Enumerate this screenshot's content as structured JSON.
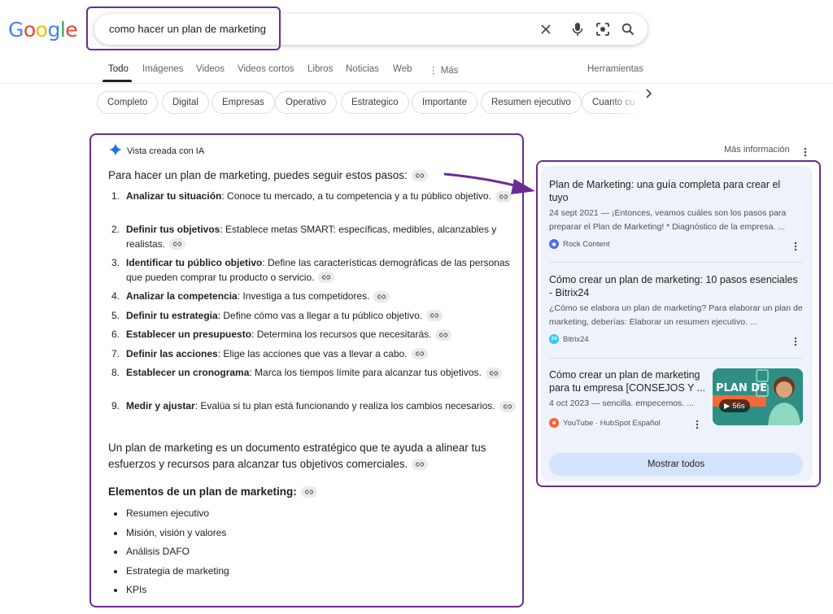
{
  "logo": {
    "text": "Google"
  },
  "search": {
    "query": "como hacer un plan de marketing"
  },
  "tabs": {
    "items": [
      "Todo",
      "Imágenes",
      "Videos",
      "Videos cortos",
      "Libros",
      "Noticias",
      "Web"
    ],
    "more": "Más",
    "tools": "Herramientas"
  },
  "chips": [
    "Completo",
    "Digital",
    "Empresas",
    "Operativo",
    "Estrategico",
    "Importante",
    "Resumen ejecutivo",
    "Cuanto cu"
  ],
  "ai_overview": {
    "header": "Vista creada con IA",
    "intro": "Para hacer un plan de marketing, puedes seguir estos pasos:",
    "steps": [
      {
        "num": "1.",
        "bold": "Analizar tu situación",
        "text": ": Conoce tu mercado, a tu competencia y a tu público objetivo."
      },
      {
        "num": "2.",
        "bold": "Definir tus objetivos",
        "text": ": Establece metas SMART: específicas, medibles, alcanzables y realistas."
      },
      {
        "num": "3.",
        "bold": "Identificar tu público objetivo",
        "text": ": Define las características demográficas de las personas que pueden comprar tu producto o servicio."
      },
      {
        "num": "4.",
        "bold": "Analizar la competencia",
        "text": ": Investiga a tus competidores."
      },
      {
        "num": "5.",
        "bold": "Definir tu estrategia",
        "text": ": Define cómo vas a llegar a tu público objetivo."
      },
      {
        "num": "6.",
        "bold": "Establecer un presupuesto",
        "text": ": Determina los recursos que necesitarás."
      },
      {
        "num": "7.",
        "bold": "Definir las acciones",
        "text": ": Elige las acciones que vas a llevar a cabo."
      },
      {
        "num": "8.",
        "bold": "Establecer un cronograma",
        "text": ": Marca los tiempos límite para alcanzar tus objetivos."
      },
      {
        "num": "9.",
        "bold": "Medir y ajustar",
        "text": ": Evalúa si tu plan está funcionando y realiza los cambios necesarios."
      }
    ],
    "paragraph": "Un plan de marketing es un documento estratégico que te ayuda a alinear tus esfuerzos y recursos para alcanzar tus objetivos comerciales.",
    "elements_title": "Elementos de un plan de marketing:",
    "elements": [
      "Resumen ejecutivo",
      "Misión, visión y valores",
      "Análisis DAFO",
      "Estrategia de marketing",
      "KPIs"
    ]
  },
  "more_info": "Más información",
  "sources": {
    "cards": [
      {
        "title": "Plan de Marketing: una guía completa para crear el tuyo",
        "snippet": "24 sept 2021 — ¡Entonces, veamos cuáles son los pasos para preparar el Plan de Marketing! * Diagnóstico de la empresa. ...",
        "source": "Rock Content"
      },
      {
        "title": "Cómo crear un plan de marketing: 10 pasos esenciales - Bitrix24",
        "snippet": "¿Cómo se elabora un plan de marketing? Para elaborar un plan de marketing, deberías: Elaborar un resumen ejecutivo. ...",
        "source": "Bitrix24",
        "fav_text": "24"
      },
      {
        "title": "Cómo crear un plan de marketing para tu empresa [CONSEJOS Y ...",
        "snippet": "4 oct 2023 — sencilla. empecemos. ...",
        "source": "YouTube · HubSpot Español",
        "thumb_text": "PLAN DE",
        "duration": "56s"
      }
    ],
    "show_all": "Mostrar todos"
  },
  "colors": {
    "annotation": "#6a2c91",
    "gemini_blue": "#1a73e8",
    "panel_bg": "#eef3fb",
    "show_all_bg": "#d3e3fd"
  }
}
